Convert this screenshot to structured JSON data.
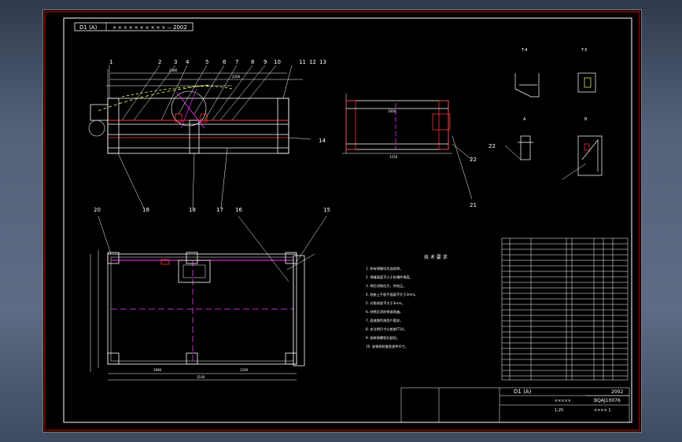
{
  "drawing": {
    "title_block_top": "D1 (A)",
    "year_top": "2002",
    "title_block_main": "D1 (A)",
    "year_main": "2002",
    "title_code": "BQAJ10076",
    "scale": "1:25",
    "sheet_info": "×××× 1",
    "sub_code": "×××××"
  },
  "balloons": [
    "1",
    "2",
    "3",
    "4",
    "5",
    "6",
    "7",
    "8",
    "9",
    "10",
    "11",
    "12",
    "13",
    "14",
    "15",
    "16",
    "17",
    "18",
    "18",
    "20",
    "21",
    "22",
    "22"
  ],
  "views": {
    "front_dims": [
      "2480",
      "2300"
    ],
    "side_dims": [
      "1250",
      "1000"
    ],
    "plan_dims": [
      "1980",
      "1200",
      "3100"
    ],
    "section_labels": [
      "T-4",
      "T-5",
      "A",
      "B"
    ]
  },
  "notes": {
    "heading": "技 术 要 求",
    "lines": [
      "1. 所有焊缝均为连续焊。",
      "2. 焊缝高度不小于较薄件厚度。",
      "3. 焊后消除应力，并校正。",
      "4. 底座上平面平面度不大于2mm。",
      "5. 对角线差不大于3mm。",
      "6. 除锈后涂防锈漆两遍。",
      "7. 面漆颜色按用户要求。",
      "8. 未注明尺寸公差按IT14。",
      "9. 各联接螺栓孔配钻。",
      "10. 安装前检查各部件尺寸。"
    ]
  },
  "colors": {
    "background": "#000000",
    "frame_red": "#cc0000",
    "line_white": "#ffffff",
    "magenta": "#ff33ff",
    "yellow": "#ffff66",
    "green": "#66ff66",
    "red": "#ff3333"
  }
}
